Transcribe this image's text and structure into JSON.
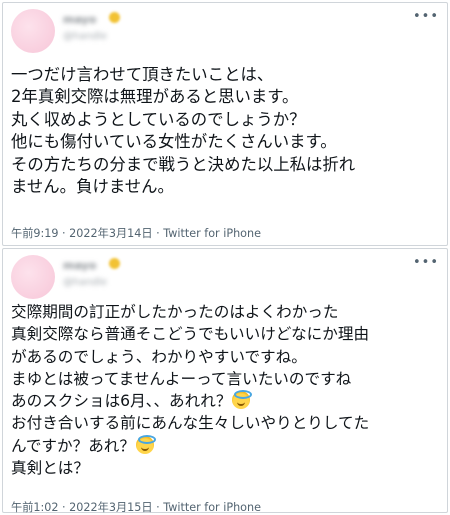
{
  "tweets": [
    {
      "name": "mayo",
      "handle": "@handle",
      "lines": [
        "一つだけ言わせて頂きたいことは、",
        "2年真剣交際は無理があると思います。",
        "丸く収めようとしているのでしょうか？",
        "他にも傷付いている女性がたくさんいます。",
        "その方たちの分まで戦うと決めた以上私は折れ",
        "ません。負けません。"
      ],
      "meta": "午前9:19 · 2022年3月14日 · Twitter for iPhone"
    },
    {
      "name": "mayo",
      "handle": "@handle",
      "lines": [
        "交際期間の訂正がしたかったのはよくわかった",
        "真剣交際なら普通そこどうでもいいけどなにか理由",
        "があるのでしょう、わかりやすいですね。",
        "まゆとは被ってませんよーって言いたいのですね",
        "あのスクショは6月、、あれれ？",
        "お付き合いする前にあんな生々しいやりとりしてた",
        "んですか？あれ？",
        "真剣とは？"
      ],
      "meta": "午前1:02 · 2022年3月15日 · Twitter for iPhone"
    }
  ],
  "more_icon": "more-horizontal-icon",
  "emoji": "smiling-face-with-halo-icon"
}
